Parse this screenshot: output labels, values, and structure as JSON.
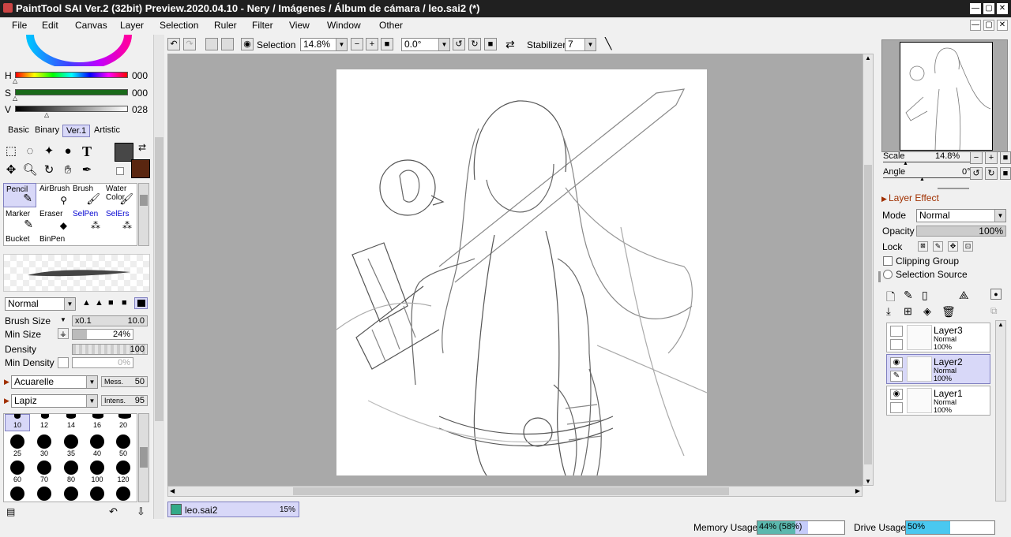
{
  "window": {
    "title": "PaintTool SAI Ver.2 (32bit) Preview.2020.04.10 - Nery / Imágenes / Álbum de cámara / leo.sai2 (*)",
    "min": "—",
    "max": "▢",
    "close": "✕"
  },
  "menu": [
    "File",
    "Edit",
    "Canvas",
    "Layer",
    "Selection",
    "Ruler",
    "Filter",
    "View",
    "Window",
    "Other"
  ],
  "toolbar": {
    "selection_label": "Selection",
    "zoom": "14.8%",
    "angle": "0.0°",
    "stabilizer_label": "Stabilizer",
    "stabilizer_value": "7"
  },
  "color": {
    "h_label": "H",
    "h_value": "000",
    "s_label": "S",
    "s_value": "000",
    "v_label": "V",
    "v_value": "028",
    "tabs": [
      "Basic",
      "Binary",
      "Ver.1",
      "Artistic"
    ],
    "primary": "#474747",
    "secondary": "#5a2610"
  },
  "brushes": [
    {
      "name": "Pencil",
      "icon": "pencil-icon"
    },
    {
      "name": "AirBrush",
      "icon": "airbrush-icon"
    },
    {
      "name": "Brush",
      "icon": "brush-icon"
    },
    {
      "name": "Water Color",
      "icon": "watercolor-icon"
    },
    {
      "name": "Marker",
      "icon": "marker-icon"
    },
    {
      "name": "Eraser",
      "icon": "eraser-icon"
    },
    {
      "name": "SelPen",
      "icon": "selpen-icon"
    },
    {
      "name": "SelErs",
      "icon": "selers-icon"
    },
    {
      "name": "Bucket",
      "icon": "bucket-icon"
    },
    {
      "name": "BinPen",
      "icon": "binpen-icon"
    }
  ],
  "brush_settings": {
    "blend_mode": "Normal",
    "brush_size_label": "Brush Size",
    "brush_size_mult": "x0.1",
    "brush_size": "10.0",
    "min_size_label": "Min Size",
    "min_size": "24%",
    "density_label": "Density",
    "density": "100",
    "min_density_label": "Min Density",
    "min_density": "0%",
    "texture": "Acuarelle",
    "mess_label": "Mess.",
    "mess": "50",
    "paper": "Lapiz",
    "intens_label": "Intens.",
    "intens": "95"
  },
  "brush_sizes": [
    "10",
    "12",
    "14",
    "16",
    "20",
    "25",
    "30",
    "35",
    "40",
    "50",
    "60",
    "70",
    "80",
    "100",
    "120"
  ],
  "document_tab": {
    "name": "leo.sai2",
    "zoom": "15%"
  },
  "navigator": {
    "scale_label": "Scale",
    "scale": "14.8%",
    "angle_label": "Angle",
    "angle": "0°"
  },
  "layer_panel": {
    "effect_label": "Layer Effect",
    "mode_label": "Mode",
    "mode": "Normal",
    "opacity_label": "Opacity",
    "opacity": "100%",
    "lock_label": "Lock",
    "clipping_label": "Clipping Group",
    "selection_source_label": "Selection Source",
    "layers": [
      {
        "name": "Layer3",
        "mode": "Normal",
        "opacity": "100%",
        "visible": false,
        "selected": false
      },
      {
        "name": "Layer2",
        "mode": "Normal",
        "opacity": "100%",
        "visible": true,
        "selected": true
      },
      {
        "name": "Layer1",
        "mode": "Normal",
        "opacity": "100%",
        "visible": true,
        "selected": false
      }
    ]
  },
  "status": {
    "memory_label": "Memory Usage",
    "memory_value": "44% (58%)",
    "memory_fraction": 0.44,
    "drive_label": "Drive Usage",
    "drive_value": "50%",
    "drive_fraction": 0.5
  }
}
